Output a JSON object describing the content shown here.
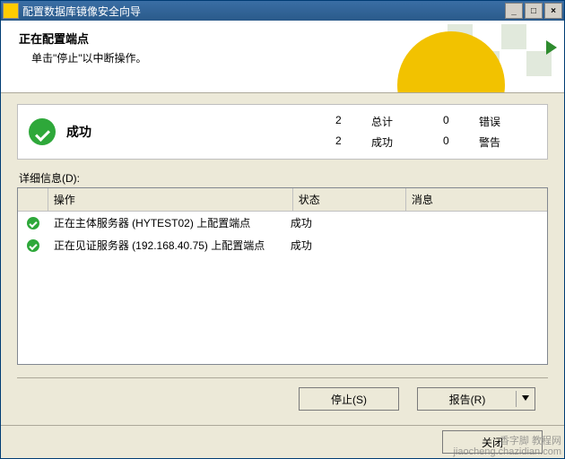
{
  "title": "配置数据库镜像安全向导",
  "header": {
    "title": "正在配置端点",
    "sub": "单击\"停止\"以中断操作。"
  },
  "summary": {
    "status": "成功",
    "stats": {
      "total_val": "2",
      "total_label": "总计",
      "success_val": "2",
      "success_label": "成功",
      "error_val": "0",
      "error_label": "错误",
      "warn_val": "0",
      "warn_label": "警告"
    }
  },
  "details_label": "详细信息(D):",
  "grid": {
    "headers": {
      "op": "操作",
      "status": "状态",
      "msg": "消息"
    },
    "rows": [
      {
        "op": "正在主体服务器 (HYTEST02) 上配置端点",
        "status": "成功",
        "msg": ""
      },
      {
        "op": "正在见证服务器 (192.168.40.75) 上配置端点",
        "status": "成功",
        "msg": ""
      }
    ]
  },
  "buttons": {
    "stop": "停止(S)",
    "report": "报告(R)",
    "close": "关闭"
  },
  "watermark": {
    "l1": "香字脚 教程网",
    "l2": "jiaocheng.chazidian.com"
  }
}
